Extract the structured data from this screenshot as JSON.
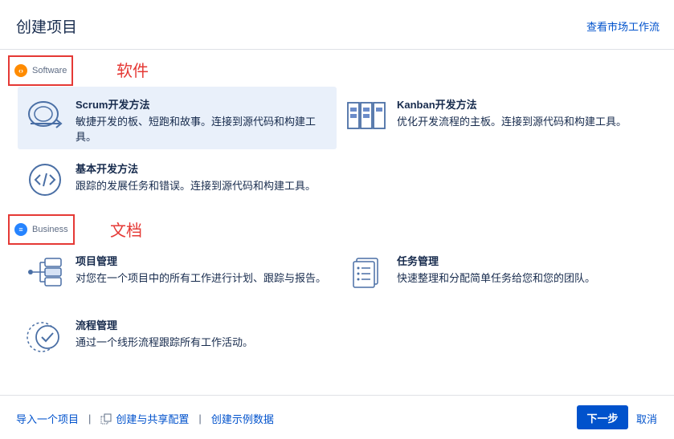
{
  "header": {
    "title": "创建项目",
    "market_link": "查看市场工作流"
  },
  "sections": {
    "software": {
      "tag": "Software",
      "annotation": "软件",
      "cards": [
        {
          "title": "Scrum开发方法",
          "desc": "敏捷开发的板、短跑和故事。连接到源代码和构建工具。",
          "icon": "scrum-cycle-icon"
        },
        {
          "title": "Kanban开发方法",
          "desc": "优化开发流程的主板。连接到源代码和构建工具。",
          "icon": "kanban-board-icon"
        },
        {
          "title": "基本开发方法",
          "desc": "跟踪的发展任务和错误。连接到源代码和构建工具。",
          "icon": "code-brackets-icon"
        }
      ]
    },
    "business": {
      "tag": "Business",
      "annotation": "文档",
      "cards": [
        {
          "title": "项目管理",
          "desc": "对您在一个项目中的所有工作进行计划、跟踪与报告。",
          "icon": "project-tree-icon"
        },
        {
          "title": "任务管理",
          "desc": "快速整理和分配简单任务给您和您的团队。",
          "icon": "task-list-icon"
        },
        {
          "title": "流程管理",
          "desc": "通过一个线形流程跟踪所有工作活动。",
          "icon": "process-check-icon"
        }
      ]
    }
  },
  "footer": {
    "import_link": "导入一个项目",
    "share_link": "创建与共享配置",
    "sample_link": "创建示例数据",
    "separator": "|",
    "next_button": "下一步",
    "cancel_button": "取消"
  },
  "colors": {
    "accent": "#0052cc",
    "selected_bg": "#e9f0fa",
    "annotation_red": "#e53935",
    "software_orange": "#ff8b00",
    "business_blue": "#2684ff"
  }
}
